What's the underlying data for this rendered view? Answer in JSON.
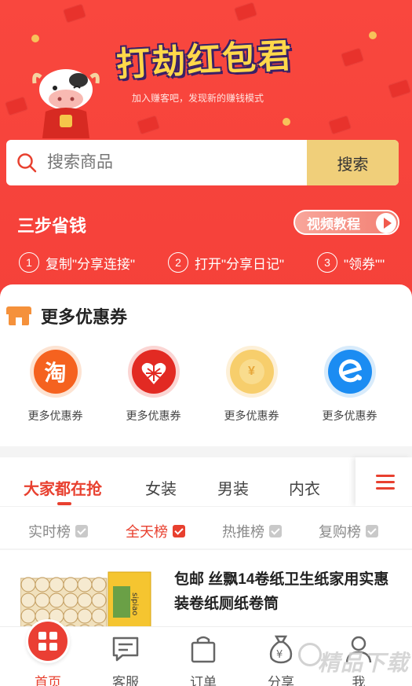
{
  "header": {
    "title_art": "打劫红包君",
    "subtitle": "加入赚客吧，发现新的赚钱模式"
  },
  "search": {
    "placeholder": "搜索商品",
    "button": "搜索"
  },
  "steps": {
    "title": "三步省钱",
    "video_button": "视频教程",
    "items": [
      {
        "num": "1",
        "text": "复制\"分享连接\""
      },
      {
        "num": "2",
        "text": "打开\"分享日记\""
      },
      {
        "num": "3",
        "text": "\"领券\"\""
      }
    ]
  },
  "coupons": {
    "title": "更多优惠券",
    "items": [
      {
        "label": "更多优惠券",
        "icon": "taobao-icon",
        "glyph": "淘"
      },
      {
        "label": "更多优惠券",
        "icon": "pinduoduo-icon"
      },
      {
        "label": "更多优惠券",
        "icon": "coin-icon",
        "glyph": "¥"
      },
      {
        "label": "更多优惠券",
        "icon": "eleme-icon"
      }
    ]
  },
  "tabs": [
    "大家都在抢",
    "女装",
    "男装",
    "内衣"
  ],
  "filters": [
    "实时榜",
    "全天榜",
    "热推榜",
    "复购榜"
  ],
  "product": {
    "title": "包邮 丝飘14卷纸卫生纸家用实惠装卷纸厕纸卷筒",
    "brand_text": "sipiao"
  },
  "bottom_nav": [
    "首页",
    "客服",
    "订单",
    "分享",
    "我"
  ],
  "watermark": "精品下载",
  "colors": {
    "primary_red": "#f5413a",
    "accent_red": "#e8402f",
    "search_button": "#f0cf7a"
  }
}
